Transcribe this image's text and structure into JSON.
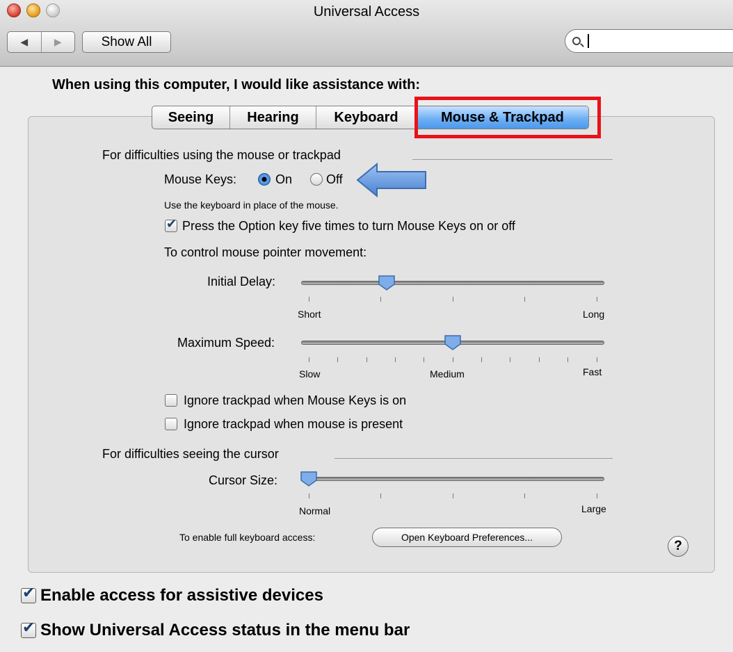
{
  "window": {
    "title": "Universal Access"
  },
  "toolbar": {
    "show_all_label": "Show All",
    "search_value": ""
  },
  "heading": "When using this computer, I would like assistance with:",
  "tabs": [
    {
      "label": "Seeing",
      "active": false
    },
    {
      "label": "Hearing",
      "active": false
    },
    {
      "label": "Keyboard",
      "active": false
    },
    {
      "label": "Mouse & Trackpad",
      "active": true
    }
  ],
  "mouse_section": {
    "title": "For difficulties using the mouse or trackpad",
    "mouse_keys_label": "Mouse Keys:",
    "on_label": "On",
    "off_label": "Off",
    "selected": "On",
    "description": "Use the keyboard in place of the mouse.",
    "option_key_label": "Press the Option key five times to turn Mouse Keys on or off",
    "option_key_checked": true,
    "pointer_movement_label": "To control mouse pointer movement:",
    "initial_delay": {
      "label": "Initial Delay:",
      "min_label": "Short",
      "max_label": "Long",
      "value": 0.27
    },
    "maximum_speed": {
      "label": "Maximum Speed:",
      "min_label": "Slow",
      "mid_label": "Medium",
      "max_label": "Fast",
      "value": 0.5
    },
    "ignore_trackpad_mouse_keys": {
      "label": "Ignore trackpad when Mouse Keys is on",
      "checked": false
    },
    "ignore_trackpad_mouse_present": {
      "label": "Ignore trackpad when mouse is present",
      "checked": false
    }
  },
  "cursor_section": {
    "title": "For difficulties seeing the cursor",
    "cursor_size": {
      "label": "Cursor Size:",
      "min_label": "Normal",
      "max_label": "Large",
      "value": 0.0
    }
  },
  "keyboard_access": {
    "label": "To enable full keyboard access:",
    "button_label": "Open Keyboard Preferences..."
  },
  "help_label": "?",
  "bottom": {
    "assistive_devices": {
      "label": "Enable access for assistive devices",
      "checked": true
    },
    "status_menu": {
      "label": "Show Universal Access status in the menu bar",
      "checked": true
    }
  },
  "colors": {
    "highlight_box": "#e81218",
    "callout_arrow": "#5b8fd6",
    "active_tab": "#6fb1f5"
  },
  "icons": [
    "close-icon",
    "minimize-icon",
    "zoom-icon",
    "back-arrow-icon",
    "forward-arrow-icon",
    "search-icon",
    "callout-arrow-icon",
    "help-icon"
  ]
}
